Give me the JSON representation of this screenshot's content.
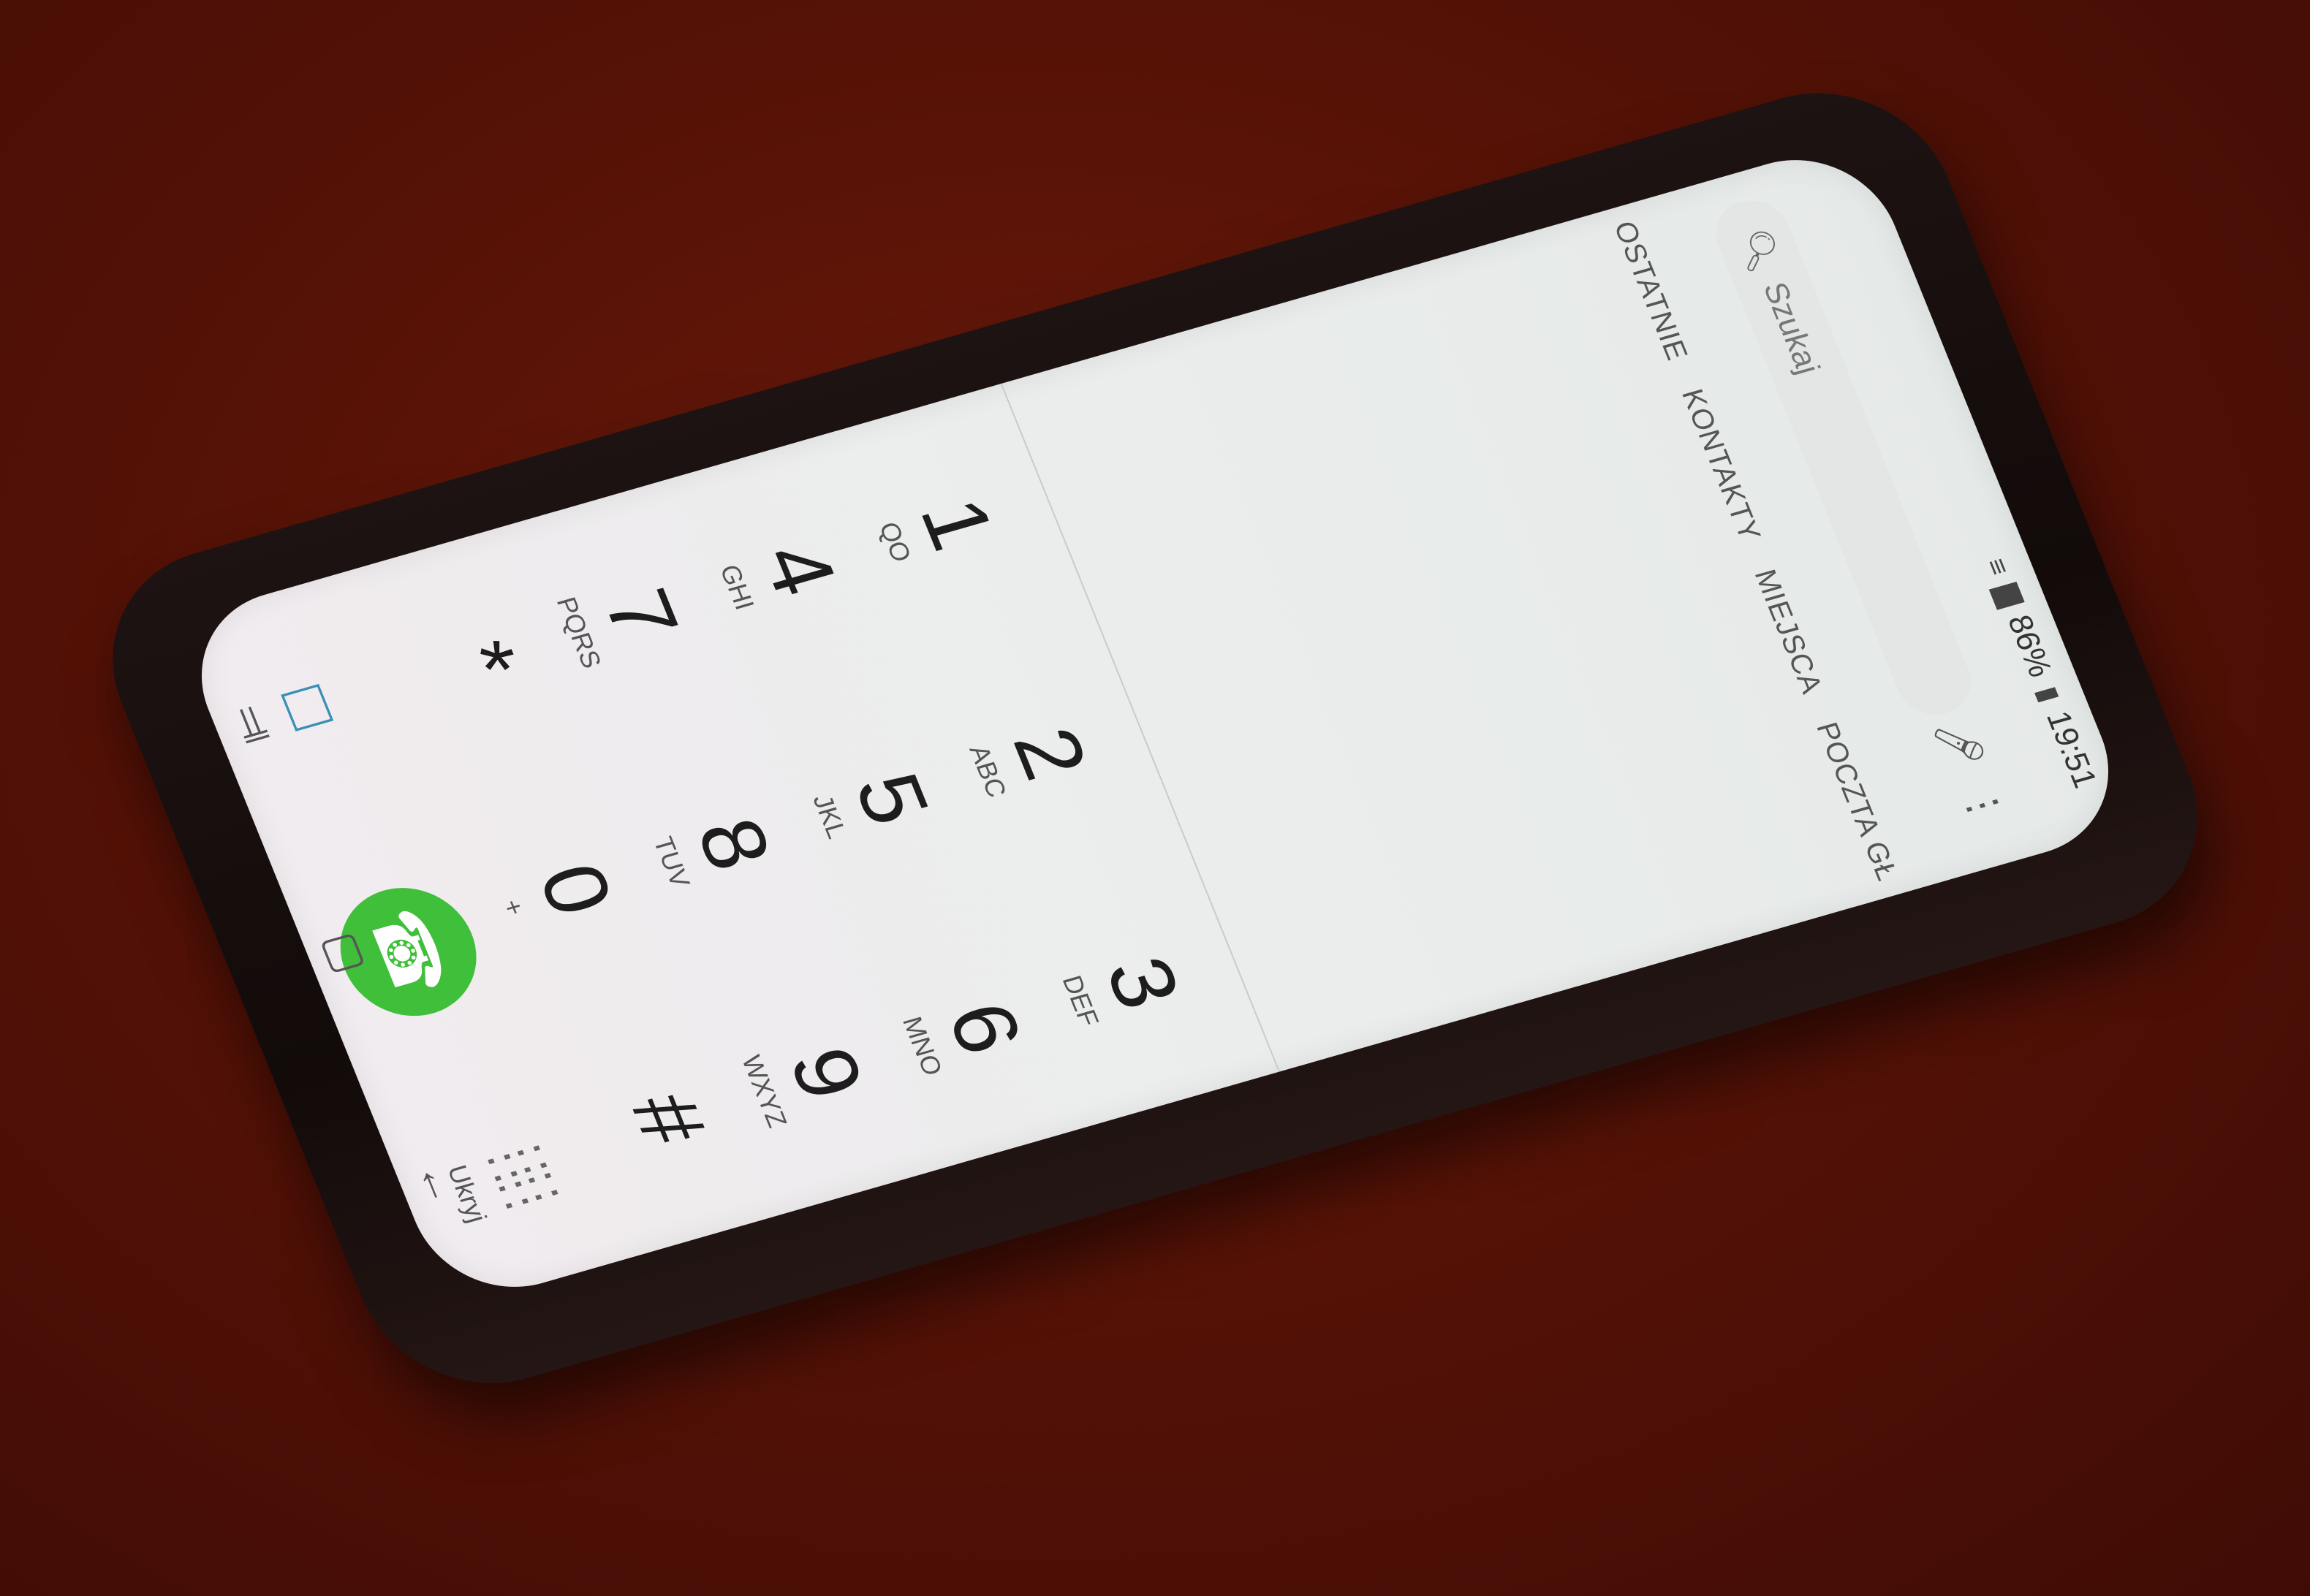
{
  "status_bar": {
    "signal_icon": "signal-icon",
    "battery": "86%",
    "time": "19:51"
  },
  "toolbar": {
    "search_placeholder": "Szukaj",
    "mic_icon": "microphone-icon",
    "more_icon": "more-vertical-icon"
  },
  "tabs": [
    {
      "label": "OSTATNIE"
    },
    {
      "label": "KONTAKTY"
    },
    {
      "label": "MIEJSCA"
    },
    {
      "label": "POCZTA GŁ"
    }
  ],
  "keypad": [
    {
      "digit": "1",
      "letters": "QO"
    },
    {
      "digit": "2",
      "letters": "ABC"
    },
    {
      "digit": "3",
      "letters": "DEF"
    },
    {
      "digit": "4",
      "letters": "GHI"
    },
    {
      "digit": "5",
      "letters": "JKL"
    },
    {
      "digit": "6",
      "letters": "MNO"
    },
    {
      "digit": "7",
      "letters": "PQRS"
    },
    {
      "digit": "8",
      "letters": "TUV"
    },
    {
      "digit": "9",
      "letters": "WXYZ"
    },
    {
      "digit": "*",
      "letters": ""
    },
    {
      "digit": "0",
      "letters": "+"
    },
    {
      "digit": "#",
      "letters": ""
    }
  ],
  "actions": {
    "message_icon": "message-icon",
    "call_icon": "phone-icon",
    "hide_label": "Ukryj"
  },
  "nav": {
    "recent_icon": "recent-apps-icon",
    "home_icon": "home-icon",
    "back_icon": "back-icon"
  },
  "colors": {
    "call_button": "#3fbf3a",
    "message_icon": "#3a8fb7",
    "background": "#561206"
  }
}
